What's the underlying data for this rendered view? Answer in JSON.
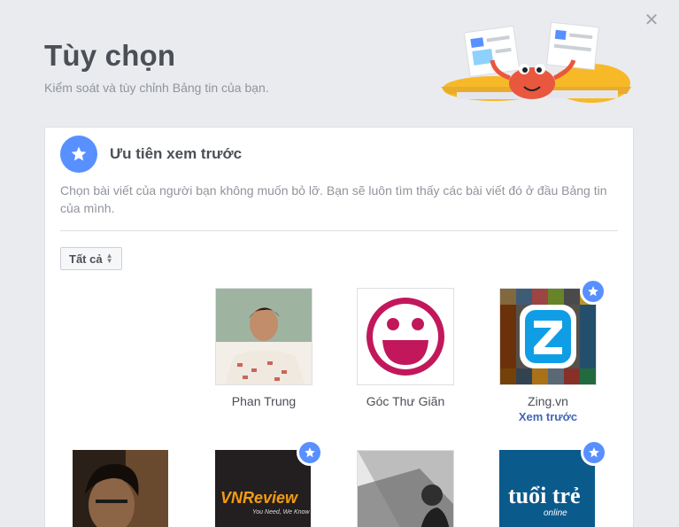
{
  "dialog": {
    "close_icon": "close-icon",
    "title": "Tùy chọn",
    "subtitle": "Kiểm soát và tùy chỉnh Bảng tin của bạn."
  },
  "section": {
    "icon": "star-icon",
    "title": "Ưu tiên xem trước",
    "description": "Chọn bài viết của người bạn không muốn bỏ lỡ. Bạn sẽ luôn tìm thấy các bài viết đó ở đầu Bảng tin của mình."
  },
  "filter": {
    "selected": "Tất cả"
  },
  "tiles": [
    {
      "name": "Phan Trung",
      "status": "",
      "favorited": false
    },
    {
      "name": "Góc Thư Giãn",
      "status": "",
      "favorited": false
    },
    {
      "name": "Zing.vn",
      "status": "Xem trước",
      "favorited": true
    },
    {
      "name": "",
      "status": "",
      "favorited": false
    },
    {
      "name": "",
      "status": "",
      "favorited": true,
      "logo_text": "VNReview",
      "logo_tagline": "You Need, We Know"
    },
    {
      "name": "",
      "status": "",
      "favorited": false
    },
    {
      "name": "",
      "status": "",
      "favorited": true,
      "logo_text": "tuổi trẻ",
      "logo_sub": "online"
    }
  ],
  "colors": {
    "accent": "#5890ff",
    "link": "#4267b2",
    "background": "#e9ebee"
  }
}
